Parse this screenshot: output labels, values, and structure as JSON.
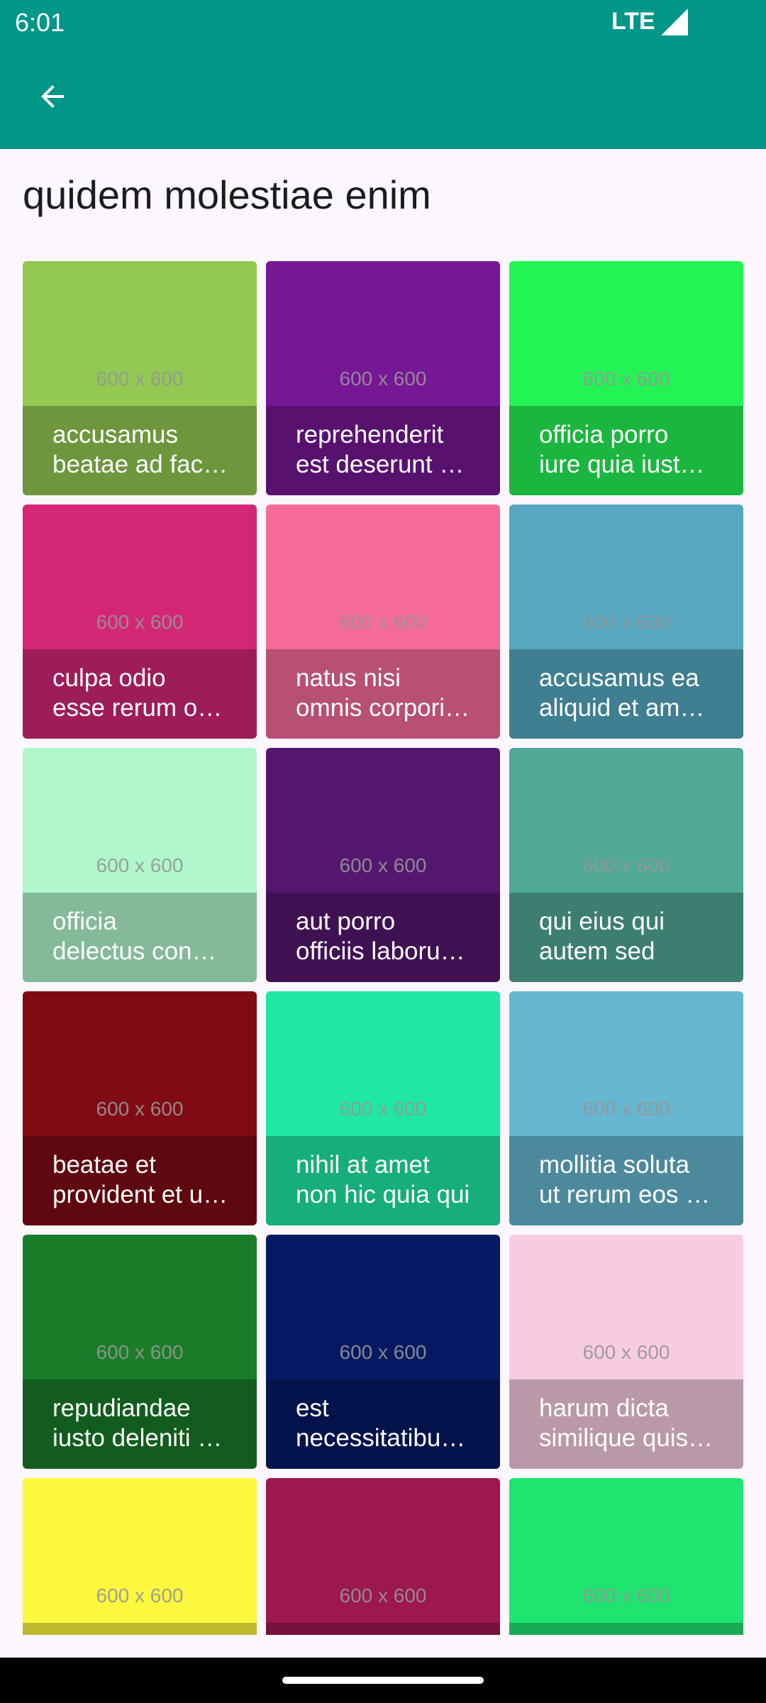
{
  "status_bar": {
    "time": "6:01",
    "network": "LTE"
  },
  "app_bar": {
    "back_icon": "arrow-left-icon"
  },
  "page": {
    "title": "quidem molestiae enim"
  },
  "placeholder_label": "600 x 600",
  "photos": [
    {
      "color": "#92C952",
      "line1": "accusamus",
      "line2": "beatae ad facilis cum similique qui sunt"
    },
    {
      "color": "#771796",
      "line1": "reprehenderit",
      "line2": "est deserunt velit ipsam"
    },
    {
      "color": "#24F355",
      "line1": "officia porro",
      "line2": "iure quia iusto qui ipsa ut modi"
    },
    {
      "color": "#D32776",
      "line1": "culpa odio",
      "line2": "esse rerum omnis laboriosam voluptate repudiandae"
    },
    {
      "color": "#F66B97",
      "line1": "natus nisi",
      "line2": "omnis corporis facere molestiae rerum in"
    },
    {
      "color": "#56A8C2",
      "line1": "accusamus ea",
      "line2": "aliquid et amet sequi nemo"
    },
    {
      "color": "#B0F7CC",
      "line1": "officia",
      "line2": "delectus consequatur vero aut veniam explicabo molestias"
    },
    {
      "color": "#54176F",
      "line1": "aut porro",
      "line2": "officiis laborum odit ea laudantium corporis"
    },
    {
      "color": "#51AA97",
      "line1": "qui eius qui",
      "line2": "autem sed"
    },
    {
      "color": "#810B14",
      "line1": "beatae et",
      "line2": "provident et ut vel"
    },
    {
      "color": "#1EE8A4",
      "line1": "nihil at amet",
      "line2": "non hic quia qui"
    },
    {
      "color": "#66B7D2",
      "line1": "mollitia soluta",
      "line2": "ut rerum eos aliquam consequatur perspiciatis maiores"
    },
    {
      "color": "#197D29",
      "line1": "repudiandae",
      "line2": "iusto deleniti rerum"
    },
    {
      "color": "#061A64",
      "line1": "est",
      "line2": "necessitatibus architecto ut laborum"
    },
    {
      "color": "#F7CCE1",
      "line1": "harum dicta",
      "line2": "similique quis dolore earum ex qui"
    },
    {
      "color": "#FDF73E",
      "line1": "",
      "line2": ""
    },
    {
      "color": "#9C184F",
      "line1": "",
      "line2": ""
    },
    {
      "color": "#1FE46F",
      "line1": "",
      "line2": ""
    }
  ]
}
